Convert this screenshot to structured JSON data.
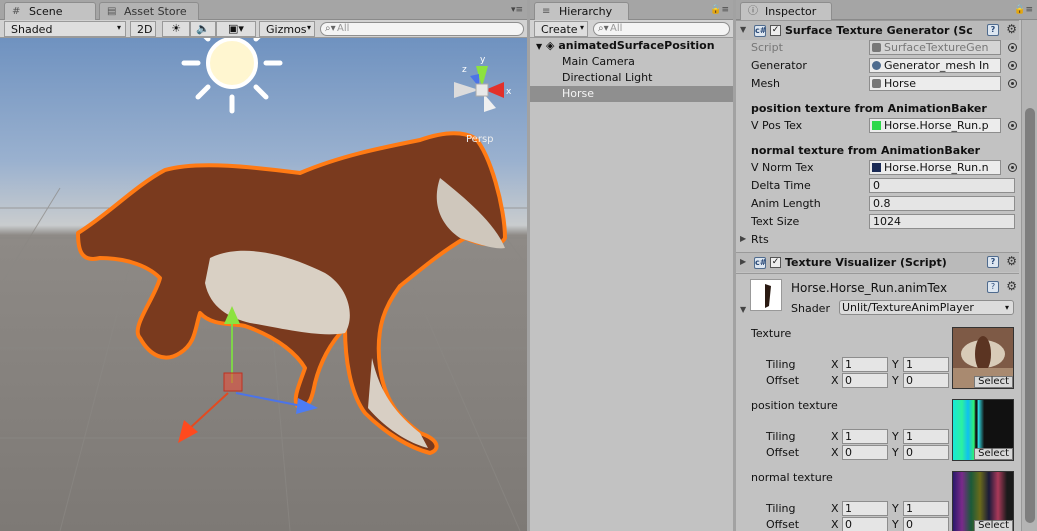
{
  "scene": {
    "tab_label": "Scene",
    "asset_store_tab": "Asset Store",
    "shading_mode": "Shaded",
    "mode_2d": "2D",
    "gizmos_label": "Gizmos",
    "search_placeholder": "All",
    "persp_label": "Persp",
    "gizmo_axes": {
      "x": "x",
      "y": "y",
      "z": "z"
    }
  },
  "hierarchy": {
    "tab_label": "Hierarchy",
    "create_label": "Create",
    "search_placeholder": "All",
    "scene_name": "animatedSurfacePosition",
    "items": [
      {
        "label": "Main Camera"
      },
      {
        "label": "Directional Light"
      },
      {
        "label": "Horse"
      }
    ]
  },
  "inspector": {
    "tab_label": "Inspector",
    "component1": {
      "title": "Surface Texture Generator (Sc",
      "script_label": "Script",
      "script_value": "SurfaceTextureGen",
      "generator_label": "Generator",
      "generator_value": "Generator_mesh In",
      "mesh_label": "Mesh",
      "mesh_value": "Horse",
      "pos_section": "position texture from AnimationBaker",
      "vpos_label": "V Pos Tex",
      "vpos_value": "Horse.Horse_Run.p",
      "norm_section": "normal texture from AnimationBaker",
      "vnorm_label": "V Norm Tex",
      "vnorm_value": "Horse.Horse_Run.n",
      "delta_label": "Delta Time",
      "delta_value": "0",
      "anim_label": "Anim Length",
      "anim_value": "0.8",
      "size_label": "Text Size",
      "size_value": "1024",
      "rts_label": "Rts"
    },
    "component2": {
      "title": "Texture Visualizer (Script)"
    },
    "material": {
      "name": "Horse.Horse_Run.animTex",
      "shader_label": "Shader",
      "shader_value": "Unlit/TextureAnimPlayer",
      "textures": [
        {
          "label": "Texture",
          "tiling_label": "Tiling",
          "offset_label": "Offset",
          "tx": "1",
          "ty": "1",
          "ox": "0",
          "oy": "0",
          "select": "Select"
        },
        {
          "label": "position texture",
          "tiling_label": "Tiling",
          "offset_label": "Offset",
          "tx": "1",
          "ty": "1",
          "ox": "0",
          "oy": "0",
          "select": "Select"
        },
        {
          "label": "normal texture",
          "tiling_label": "Tiling",
          "offset_label": "Offset",
          "tx": "1",
          "ty": "1",
          "ox": "0",
          "oy": "0",
          "select": "Select"
        }
      ],
      "x_label": "X",
      "y_label": "Y"
    }
  },
  "colors": {
    "selection_outline": "#ff7a14",
    "selected_row": "#8f8f8f"
  }
}
